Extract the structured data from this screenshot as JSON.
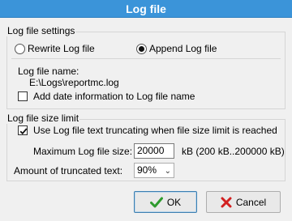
{
  "window": {
    "title": "Log file"
  },
  "settings_group": {
    "legend": "Log file settings",
    "rewrite_label": "Rewrite Log file",
    "append_label": "Append Log file",
    "selected_mode": "append",
    "name_label": "Log file name:",
    "name_value": "E:\\Logs\\reportmc.log",
    "add_date_label": "Add date information to Log file name",
    "add_date_checked": false
  },
  "size_group": {
    "legend": "Log file size limit",
    "truncate_label": "Use Log file text truncating when file size limit is reached",
    "truncate_checked": true,
    "max_size_label": "Maximum Log file size:",
    "max_size_value": "20000",
    "max_size_unit": "kB  (200 kB..200000 kB)",
    "amount_label": "Amount of truncated text:",
    "amount_value": "90%"
  },
  "buttons": {
    "ok_label": "OK",
    "cancel_label": "Cancel"
  },
  "colors": {
    "titlebar": "#3b94d9",
    "ok_check": "#2e9b2e",
    "cancel_x": "#d22020"
  }
}
